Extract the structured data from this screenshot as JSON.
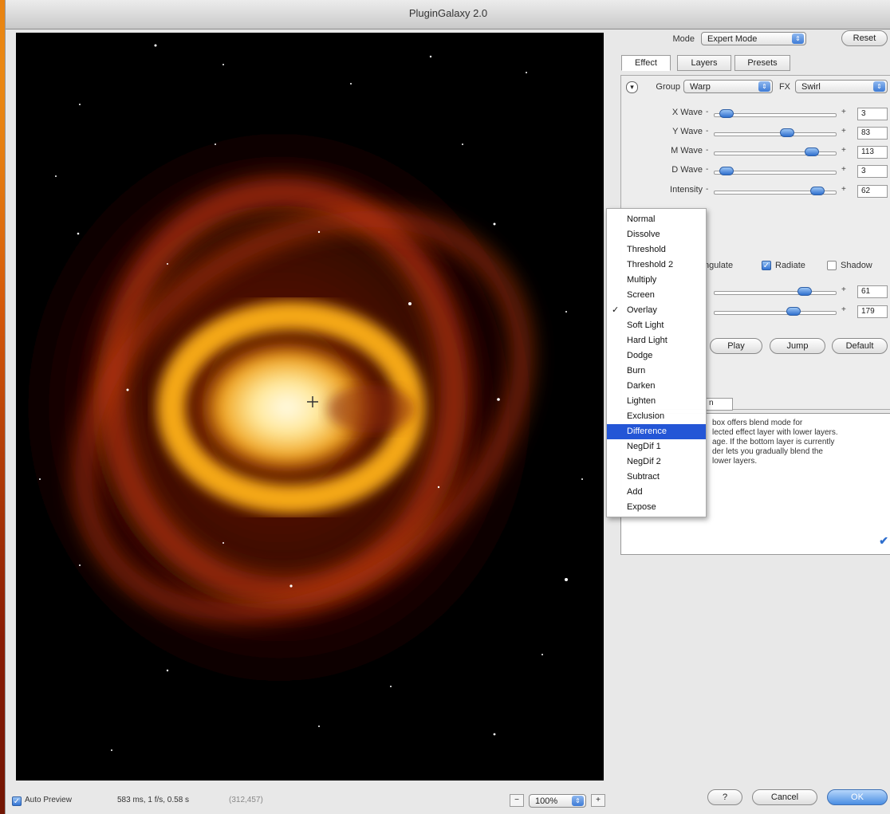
{
  "window": {
    "title": "PluginGalaxy 2.0"
  },
  "mode": {
    "label": "Mode",
    "value": "Expert Mode",
    "reset": "Reset"
  },
  "tabs": [
    {
      "label": "Effect",
      "active": true
    },
    {
      "label": "Layers",
      "active": false
    },
    {
      "label": "Presets",
      "active": false
    }
  ],
  "group": {
    "label": "Group",
    "value": "Warp",
    "fx_label": "FX",
    "fx_value": "Swirl"
  },
  "sliders": [
    {
      "label": "X Wave",
      "value": "3",
      "level": 0.05
    },
    {
      "label": "Y Wave",
      "value": "83",
      "level": 0.62
    },
    {
      "label": "M Wave",
      "value": "113",
      "level": 0.85
    },
    {
      "label": "D Wave",
      "value": "3",
      "level": 0.05
    },
    {
      "label": "Intensity",
      "value": "62",
      "level": 0.9
    }
  ],
  "options": {
    "angulate": "ngulate",
    "radiate": "Radiate",
    "shadow": "Shadow"
  },
  "sliders2": [
    {
      "value": "61",
      "level": 0.78
    },
    {
      "value": "179",
      "level": 0.68
    }
  ],
  "buttons": {
    "play": "Play",
    "jump": "Jump",
    "default": "Default",
    "help": "?",
    "cancel": "Cancel",
    "ok": "OK"
  },
  "small_field": "n",
  "description": "box offers blend mode for\nlected effect layer with lower layers.\nage. If the bottom layer is currently\nder lets you gradually blend the\n lower layers.",
  "blend_menu": {
    "items": [
      "Normal",
      "Dissolve",
      "Threshold",
      "Threshold 2",
      "Multiply",
      "Screen",
      "Overlay",
      "Soft Light",
      "Hard Light",
      "Dodge",
      "Burn",
      "Darken",
      "Lighten",
      "Exclusion",
      "Difference",
      "NegDif 1",
      "NegDif 2",
      "Subtract",
      "Add",
      "Expose"
    ],
    "checked": "Overlay",
    "highlighted": "Difference"
  },
  "footer": {
    "auto_preview": "Auto Preview",
    "timing": "583 ms, 1 f/s, 0.58 s",
    "coords": "(312,457)",
    "zoom_minus": "−",
    "zoom": "100%",
    "zoom_plus": "+"
  },
  "colors": {
    "accent": "#2456d6",
    "button_blue": "#4a8ee3"
  }
}
